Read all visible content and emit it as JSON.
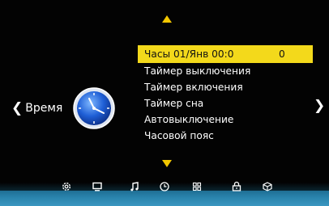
{
  "nav": {
    "left_label": "Время",
    "left_chevron": "❮",
    "right_chevron": "❯"
  },
  "menu": {
    "items": [
      {
        "label": "Часы 01/Янв 00:0",
        "value": "0",
        "selected": true
      },
      {
        "label": "Таймер выключения"
      },
      {
        "label": "Таймер включения"
      },
      {
        "label": "Таймер сна"
      },
      {
        "label": "Автовыключение"
      },
      {
        "label": "Часовой пояс"
      }
    ]
  },
  "bottom_icons": [
    "settings-gear-icon",
    "monitor-icon",
    "music-note-icon",
    "clock-icon",
    "grid-icon",
    "lock-icon",
    "box-icon"
  ],
  "colors": {
    "highlight": "#f3d91b",
    "arrow": "#f2c700",
    "bar": "#2a84ad"
  }
}
